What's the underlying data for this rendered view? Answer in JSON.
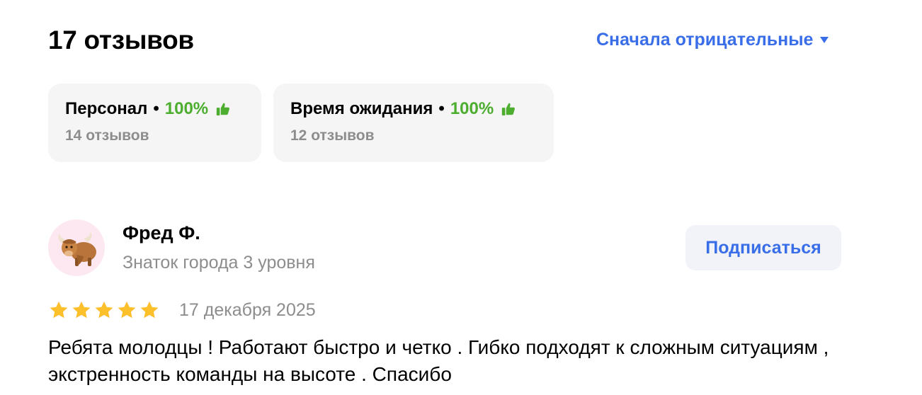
{
  "reviews_header": {
    "title": "17 отзывов",
    "sort_label": "Сначала отрицательные",
    "sort_icon": "caret-down-icon"
  },
  "aspects": [
    {
      "name": "Персонал",
      "percent": "100%",
      "count": "14 отзывов",
      "icon": "thumbs-up-icon"
    },
    {
      "name": "Время ожидания",
      "percent": "100%",
      "count": "12 отзывов",
      "icon": "thumbs-up-icon"
    }
  ],
  "review": {
    "author": "Фред Ф.",
    "level": "Знаток города 3 уровня",
    "subscribe_label": "Подписаться",
    "rating": 5,
    "rating_max": 5,
    "date": "17 декабря 2025",
    "text": "Ребята молодцы ! Работают быстро и четко . Гибко подходят к сложным ситуациям , экстренность команды на высоте . Спасибо",
    "avatar_icon": "yak-avatar-icon"
  },
  "colors": {
    "accent_blue": "#3a6ee8",
    "positive_green": "#4cad2f",
    "star_yellow": "#fcc02d",
    "muted_text": "#8d8d8d",
    "card_bg": "#f5f5f5"
  }
}
